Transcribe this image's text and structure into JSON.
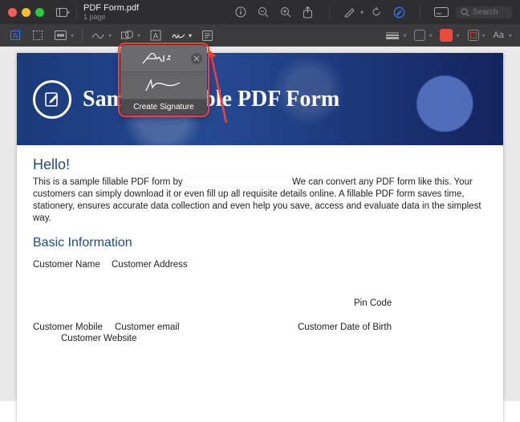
{
  "window": {
    "title": "PDF Form.pdf",
    "subtitle": "1 page",
    "traffic_colors": {
      "close": "#ff5f57",
      "min": "#febc2e",
      "max": "#28c840"
    },
    "search_placeholder": "Search"
  },
  "markup_toolbar": {
    "text_style_label": "Aa",
    "fill_color": "#eb4b3f"
  },
  "signature_popup": {
    "create_label": "Create Signature"
  },
  "doc": {
    "banner_title": "Sample Fillable PDF Form",
    "hello": "Hello!",
    "intro_pre": "This is a sample fillable PDF form by ",
    "intro_post": " We can convert any PDF form like this. Your customers can simply download it or even fill up all requisite details online. A fillable PDF form saves time, stationery, ensures accurate data collection and even help you save, access and evaluate data in the simplest way.",
    "section_basic": "Basic Information",
    "fields": {
      "name": "Customer Name",
      "address_label": "Customer Address",
      "pin": "Pin Code",
      "mobile": "Customer Mobile",
      "email": "Customer email",
      "website": "Customer Website",
      "dob": "Customer Date of Birth"
    }
  }
}
